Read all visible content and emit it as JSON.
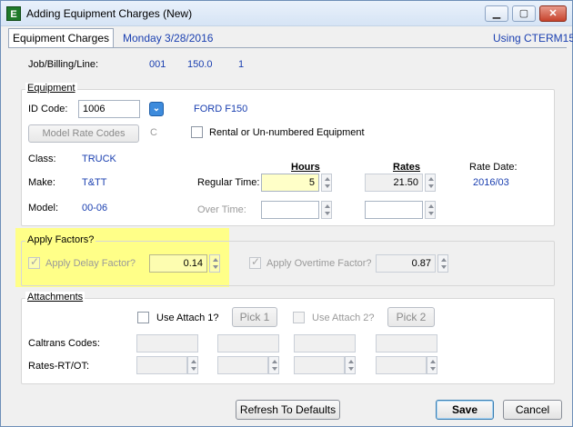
{
  "window": {
    "title": "Adding Equipment Charges  (New)",
    "app_icon_letter": "E"
  },
  "header": {
    "tab_label": "Equipment Charges",
    "date": "Monday  3/28/2016",
    "using": "Using CTERM15"
  },
  "job": {
    "label": "Job/Billing/Line:",
    "job": "001",
    "billing": "150.0",
    "line": "1"
  },
  "equipment": {
    "group_title": "Equipment",
    "id_code_label": "ID Code:",
    "id_code_value": "1006",
    "description": "FORD F150",
    "model_rate_codes_label": "Model Rate Codes",
    "rate_code_value": "C",
    "rental_label": "Rental or Un-numbered Equipment",
    "class_label": "Class:",
    "class_value": "TRUCK",
    "make_label": "Make:",
    "make_value": "T&TT",
    "model_label": "Model:",
    "model_value": "00-06",
    "hours_header": "Hours",
    "rates_header": "Rates",
    "rate_date_label": "Rate Date:",
    "rate_date_value": "2016/03",
    "regular_time_label": "Regular Time:",
    "regular_hours": "5",
    "regular_rate": "21.50",
    "over_time_label": "Over Time:",
    "over_hours": "",
    "over_rate": ""
  },
  "factors": {
    "group_title": "Apply Factors?",
    "delay_label": "Apply Delay Factor?",
    "delay_value": "0.14",
    "overtime_label": "Apply Overtime Factor?",
    "overtime_value": "0.87",
    "highlight_color": "#ffff88"
  },
  "attachments": {
    "group_title": "Attachments",
    "use_attach1_label": "Use Attach 1?",
    "pick1_label": "Pick 1",
    "use_attach2_label": "Use Attach 2?",
    "pick2_label": "Pick 2",
    "caltrans_label": "Caltrans Codes:",
    "rates_label": "Rates-RT/OT:"
  },
  "footer": {
    "refresh_label": "Refresh To Defaults",
    "save_label": "Save",
    "cancel_label": "Cancel"
  }
}
